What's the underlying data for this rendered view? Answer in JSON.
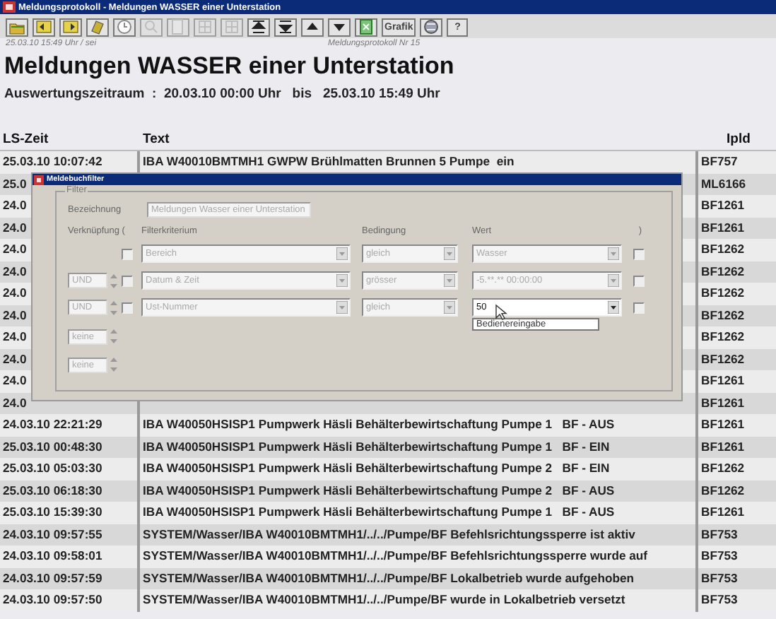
{
  "window": {
    "title": "Meldungsprotokoll - Meldungen WASSER einer Unterstation"
  },
  "toolbar": [
    {
      "kind": "icon",
      "disabled": false
    },
    {
      "kind": "icon",
      "disabled": false
    },
    {
      "kind": "icon",
      "disabled": false
    },
    {
      "kind": "icon",
      "disabled": false
    },
    {
      "kind": "icon",
      "disabled": false
    },
    {
      "kind": "icon",
      "disabled": true
    },
    {
      "kind": "icon",
      "disabled": true
    },
    {
      "kind": "icon",
      "disabled": true
    },
    {
      "kind": "icon",
      "disabled": true
    },
    {
      "kind": "icon",
      "disabled": false
    },
    {
      "kind": "icon",
      "disabled": false
    },
    {
      "kind": "icon",
      "disabled": false
    },
    {
      "kind": "icon",
      "disabled": false
    },
    {
      "kind": "icon",
      "disabled": false
    },
    {
      "kind": "text",
      "label": "Grafik",
      "disabled": false
    },
    {
      "kind": "icon",
      "disabled": false
    },
    {
      "kind": "text",
      "label": "?",
      "disabled": false
    }
  ],
  "report": {
    "timestamp": "25.03.10 15:49 Uhr / sei",
    "number": "Meldungsprotokoll Nr 15",
    "heading": "Meldungen WASSER einer Unterstation",
    "period": "Auswertungszeitraum  :  20.03.10 00:00 Uhr   bis   25.03.10 15:49 Uhr"
  },
  "table": {
    "columns": [
      "LS-Zeit",
      "Text",
      "Ipld"
    ],
    "rows": [
      {
        "time": "25.03.10 10:07:42",
        "text": "IBA W40010BMTMH1 GWPW Brühlmatten Brunnen 5 Pumpe  ein",
        "ipld": "BF757"
      },
      {
        "time": "25.0",
        "ipld": "ML6166"
      },
      {
        "time": "24.0",
        "ipld": "BF1261"
      },
      {
        "time": "24.0",
        "ipld": "BF1261"
      },
      {
        "time": "24.0",
        "ipld": "BF1262"
      },
      {
        "time": "24.0",
        "ipld": "BF1262"
      },
      {
        "time": "24.0",
        "ipld": "BF1262"
      },
      {
        "time": "24.0",
        "ipld": "BF1262"
      },
      {
        "time": "24.0",
        "ipld": "BF1262"
      },
      {
        "time": "24.0",
        "ipld": "BF1262"
      },
      {
        "time": "24.0",
        "ipld": "BF1261"
      },
      {
        "time": "24.0",
        "ipld": "BF1261"
      },
      {
        "time": "24.03.10 22:21:29",
        "text": "IBA W40050HSISP1 Pumpwerk Häsli Behälterbewirtschaftung Pumpe 1   BF - AUS",
        "ipld": "BF1261"
      },
      {
        "time": "25.03.10 00:48:30",
        "text": "IBA W40050HSISP1 Pumpwerk Häsli Behälterbewirtschaftung Pumpe 1   BF - EIN",
        "ipld": "BF1261"
      },
      {
        "time": "25.03.10 05:03:30",
        "text": "IBA W40050HSISP1 Pumpwerk Häsli Behälterbewirtschaftung Pumpe 2   BF - EIN",
        "ipld": "BF1262"
      },
      {
        "time": "25.03.10 06:18:30",
        "text": "IBA W40050HSISP1 Pumpwerk Häsli Behälterbewirtschaftung Pumpe 2   BF - AUS",
        "ipld": "BF1262"
      },
      {
        "time": "25.03.10 15:39:30",
        "text": "IBA W40050HSISP1 Pumpwerk Häsli Behälterbewirtschaftung Pumpe 1   BF - AUS",
        "ipld": "BF1261"
      },
      {
        "time": "24.03.10 09:57:55",
        "text": "SYSTEM/Wasser/IBA W40010BMTMH1/../../Pumpe/BF Befehlsrichtungssperre ist aktiv",
        "ipld": "BF753"
      },
      {
        "time": "24.03.10 09:58:01",
        "text": "SYSTEM/Wasser/IBA W40010BMTMH1/../../Pumpe/BF Befehlsrichtungssperre wurde auf",
        "ipld": "BF753"
      },
      {
        "time": "24.03.10 09:57:59",
        "text": "SYSTEM/Wasser/IBA W40010BMTMH1/../../Pumpe/BF Lokalbetrieb wurde aufgehoben",
        "ipld": "BF753"
      },
      {
        "time": "24.03.10 09:57:50",
        "text": "SYSTEM/Wasser/IBA W40010BMTMH1/../../Pumpe/BF wurde in Lokalbetrieb versetzt",
        "ipld": "BF753"
      }
    ]
  },
  "dialog": {
    "title": "Meldebuchfilter",
    "group": "Filter",
    "name_label": "Bezeichnung",
    "name_value": "Meldungen Wasser einer Unterstation",
    "headers": [
      "Verknüpfung (",
      "Filterkriterium",
      "Bedingung",
      "Wert",
      ")"
    ],
    "filters": [
      {
        "open_paren": false,
        "criterion": "Bereich",
        "condition": "gleich",
        "value": {
          "text": "Wasser",
          "disabled": true
        },
        "close_paren": false
      },
      {
        "operator": "UND",
        "open_paren": false,
        "criterion": "Datum & Zeit",
        "condition": "grösser",
        "value": {
          "text": "-5.**.** 00:00:00",
          "disabled": true
        },
        "close_paren": false
      },
      {
        "operator": "UND",
        "open_paren": false,
        "criterion": "Ust-Nummer",
        "condition": "gleich",
        "value": {
          "text": "50",
          "disabled": false
        },
        "suggestion": "Bedienereingabe",
        "close_paren": false
      }
    ],
    "extra_operators": [
      "keine",
      "keine"
    ]
  }
}
